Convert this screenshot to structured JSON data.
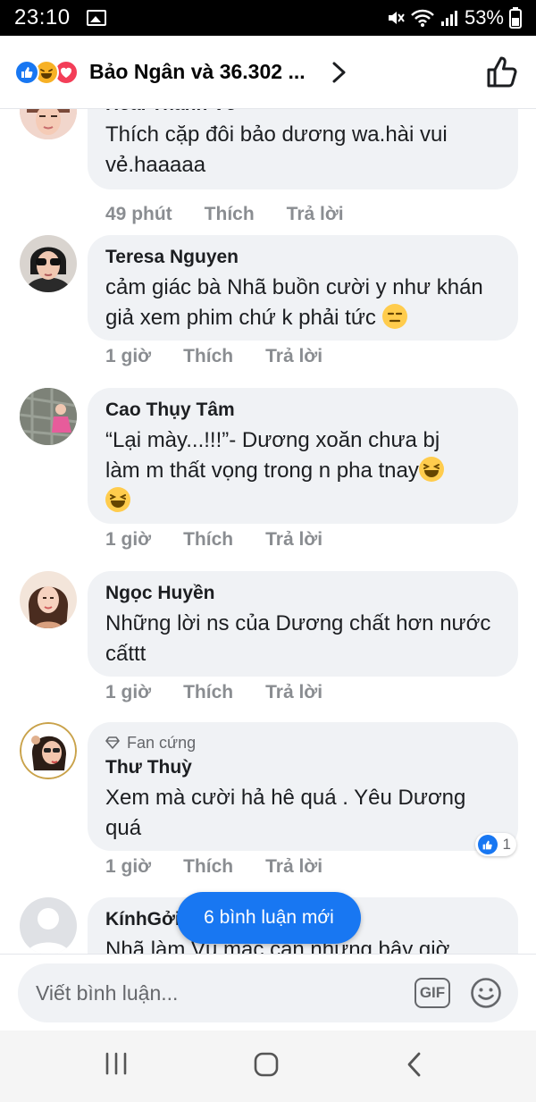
{
  "status_bar": {
    "time": "23:10",
    "battery": "53%"
  },
  "header": {
    "title": "Bảo Ngân và 36.302 ..."
  },
  "comments": [
    {
      "author": "Hoài Thanh Võ",
      "text": "Thích cặp đôi bảo dương wa.hài vui vẻ.haaaaa",
      "time": "49 phút",
      "like": "Thích",
      "reply": "Trả lời"
    },
    {
      "author": "Teresa Nguyen",
      "text": "cảm giác bà Nhã buồn cười y như khán giả xem phim chứ k phải tức",
      "time": "1 giờ",
      "like": "Thích",
      "reply": "Trả lời"
    },
    {
      "author": "Cao Thụy Tâm",
      "text_line1": "“Lại mày...!!!”- Dương xoăn chưa bj",
      "text_line2": "làm m thất vọng trong n pha tnay",
      "time": "1 giờ",
      "like": "Thích",
      "reply": "Trả lời"
    },
    {
      "author": "Ngọc Huyền",
      "text": "Những lời ns của Dương chất hơn nước cấttt",
      "time": "1 giờ",
      "like": "Thích",
      "reply": "Trả lời"
    },
    {
      "badge": "Fan cứng",
      "author": "Thư Thuỳ",
      "text": "Xem mà cười hả hê quá . Yêu Dương quá",
      "time": "1 giờ",
      "like": "Thích",
      "reply": "Trả lời",
      "reaction_count": "1"
    },
    {
      "author": "KínhGởi",
      "text": "Nhã làm Vụ mạc can nhưng bây giờ"
    }
  ],
  "new_comments_pill": "6 bình luận mới",
  "composer": {
    "placeholder": "Viết bình luận...",
    "gif_label": "GIF"
  },
  "colors": {
    "accent": "#1877f2",
    "bubble": "#f0f2f5",
    "meta_text": "#8a8d91"
  }
}
